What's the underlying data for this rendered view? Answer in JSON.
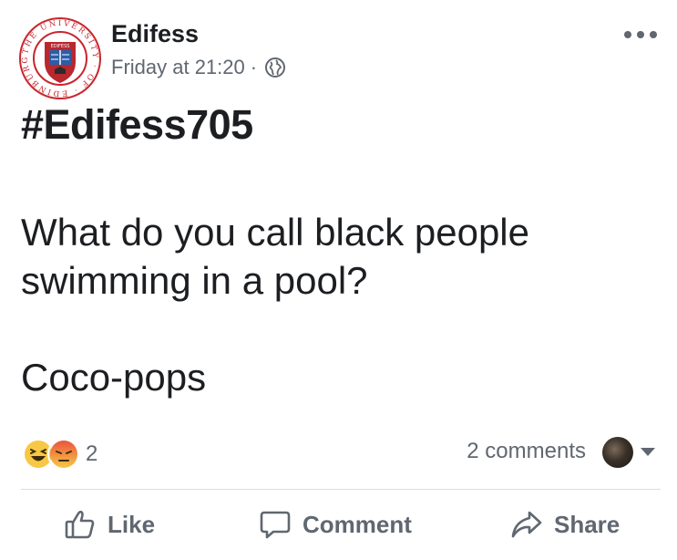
{
  "post": {
    "page_name": "Edifess",
    "timestamp": "Friday at 21:20",
    "separator": "·",
    "audience_icon": "globe-icon",
    "hashtag": "#Edifess705",
    "body": "What do you call black people\nswimming in a pool?\n\nCoco-pops"
  },
  "avatar": {
    "ring_text": "THE UNIVERSITY OF EDINBURGH",
    "shield_text": "EDIFESS",
    "colors": {
      "ring": "#c8262d",
      "shield": "#b9272f",
      "book": "#2b5ea8"
    }
  },
  "engagement": {
    "reaction_icons": [
      "haha-reaction-icon",
      "angry-reaction-icon"
    ],
    "reaction_count": "2",
    "comments": "2 comments"
  },
  "actions": {
    "like": "Like",
    "comment": "Comment",
    "share": "Share"
  },
  "colors": {
    "text": "#1c1e21",
    "muted": "#606770",
    "divider": "#dadde1"
  }
}
